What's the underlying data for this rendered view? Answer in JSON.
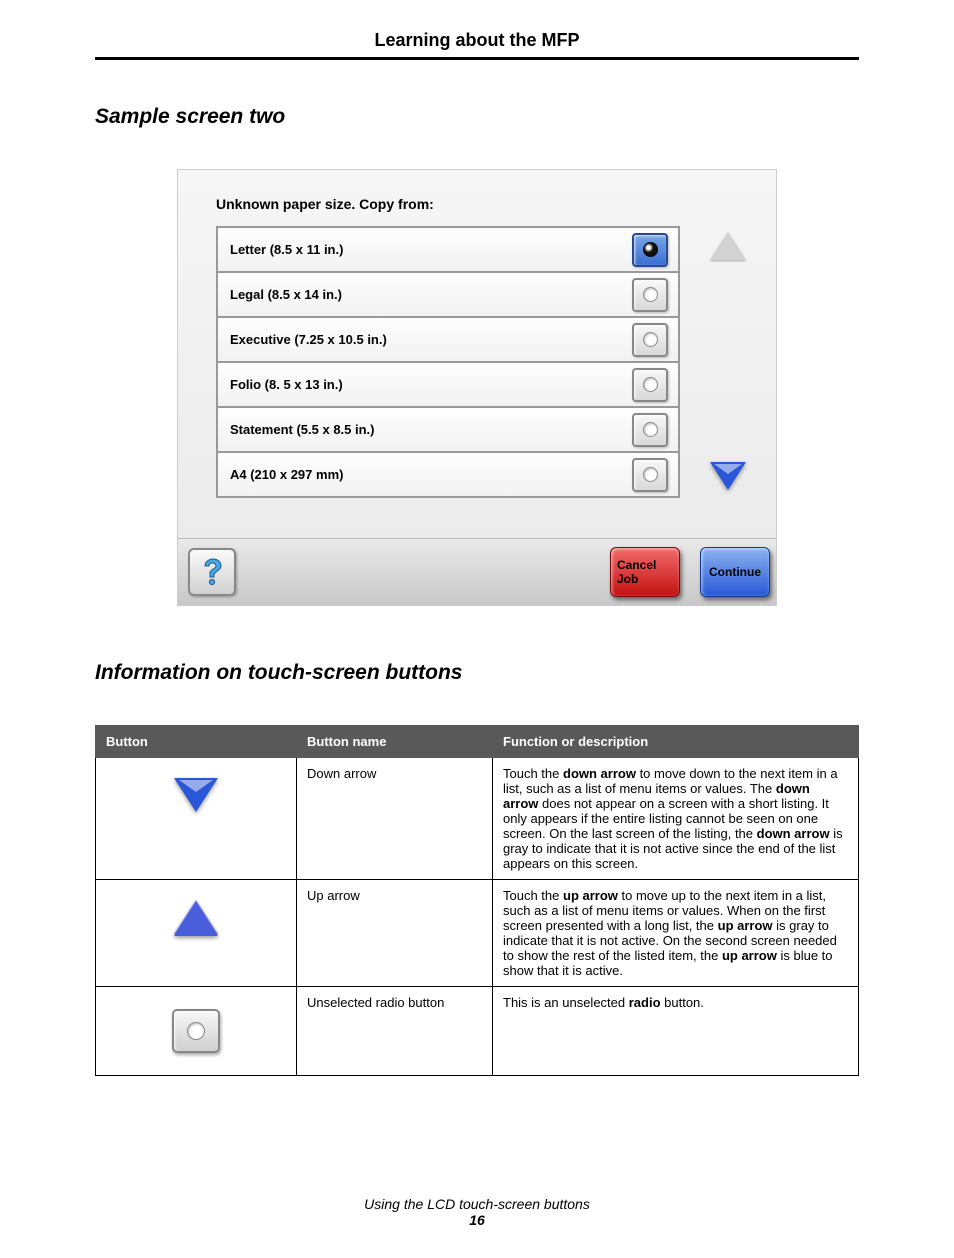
{
  "header": {
    "title": "Learning about the MFP"
  },
  "section1": {
    "heading": "Sample screen two"
  },
  "screen": {
    "caption": "Unknown paper size. Copy from:",
    "options": [
      {
        "label": "Letter (8.5 x 11 in.)",
        "selected": true
      },
      {
        "label": "Legal (8.5 x 14 in.)",
        "selected": false
      },
      {
        "label": "Executive (7.25 x 10.5 in.)",
        "selected": false
      },
      {
        "label": "Folio (8. 5 x 13 in.)",
        "selected": false
      },
      {
        "label": "Statement (5.5 x 8.5 in.)",
        "selected": false
      },
      {
        "label": "A4 (210 x 297 mm)",
        "selected": false
      }
    ],
    "cancel_label": "Cancel Job",
    "continue_label": "Continue"
  },
  "section2": {
    "heading": "Information on touch-screen buttons"
  },
  "table": {
    "headers": {
      "button": "Button",
      "name": "Button name",
      "desc": "Function or description"
    },
    "rows": [
      {
        "name": "Down arrow",
        "desc_parts": [
          "Touch the ",
          "down arrow",
          " to move down to the next item in a list, such as a list of menu items or values. The ",
          "down arrow",
          " does not appear on a screen with a short listing. It only appears if the entire listing cannot be seen on one screen. On the last screen of the listing, the ",
          "down arrow",
          " is gray to indicate that it is not active since the end of the list appears on this screen."
        ]
      },
      {
        "name": "Up arrow",
        "desc_parts": [
          "Touch the ",
          "up arrow",
          " to move up to the next item in a list, such as a list of menu items or values. When on the first screen presented with a long list, the ",
          "up arrow",
          " is gray to indicate that it is not active. On the second screen needed to show the rest of the listed item, the ",
          "up arrow",
          " is blue to show that it is active."
        ]
      },
      {
        "name": "Unselected radio button",
        "desc_parts": [
          "This is an unselected ",
          "radio",
          " button."
        ]
      }
    ]
  },
  "footer": {
    "caption": "Using the LCD touch-screen buttons",
    "page": "16"
  }
}
